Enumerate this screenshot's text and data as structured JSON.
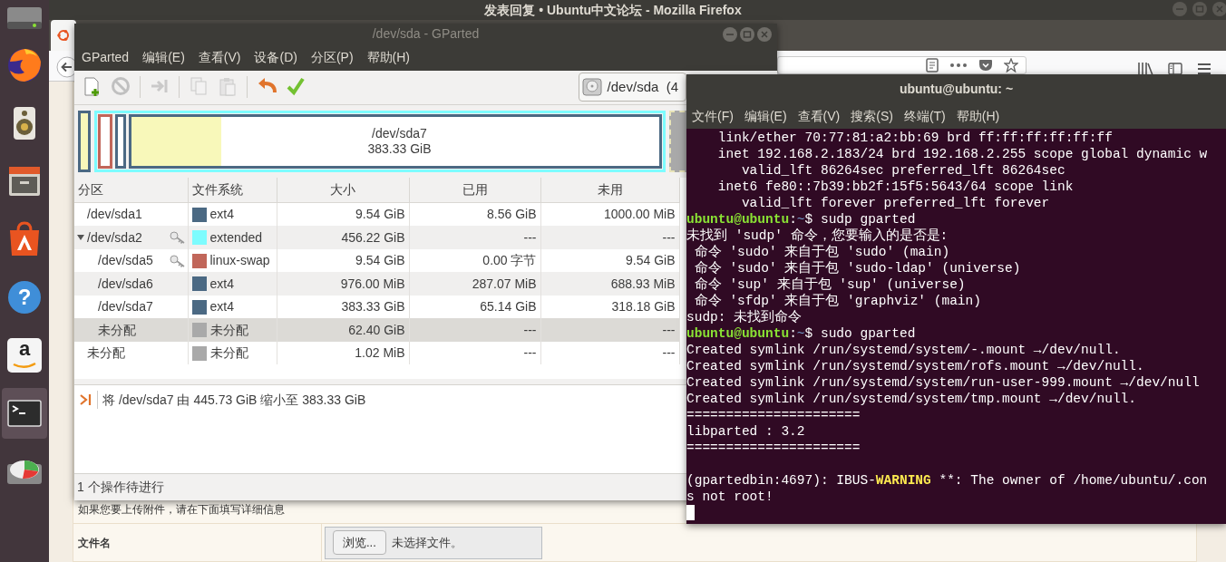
{
  "launcher": [
    {
      "kind": "drive",
      "active": false
    },
    {
      "kind": "firefox",
      "active": false
    },
    {
      "kind": "speaker",
      "active": false
    },
    {
      "kind": "files",
      "active": false
    },
    {
      "kind": "store",
      "active": false
    },
    {
      "kind": "help",
      "active": false,
      "glyph": "?"
    },
    {
      "kind": "amazon",
      "active": false,
      "glyph": "a"
    },
    {
      "kind": "terminal",
      "active": true
    },
    {
      "kind": "disk",
      "active": false
    }
  ],
  "firefox": {
    "title": "发表回复 • Ubuntu中文论坛 - Mozilla Firefox",
    "attach_hint": "如果您要上传附件，请在下面填写详细信息",
    "file_label": "文件名",
    "browse_button": "浏览...",
    "file_status": "未选择文件。"
  },
  "gparted": {
    "title": "/dev/sda - GParted",
    "menu": [
      "GParted",
      "编辑(E)",
      "查看(V)",
      "设备(D)",
      "分区(P)",
      "帮助(H)"
    ],
    "toolbar": [
      {
        "kind": "new",
        "disabled": false
      },
      {
        "kind": "delete",
        "disabled": true
      },
      {
        "kind": "separator"
      },
      {
        "kind": "resize",
        "disabled": true
      },
      {
        "kind": "separator"
      },
      {
        "kind": "copy",
        "disabled": true
      },
      {
        "kind": "paste",
        "disabled": true
      },
      {
        "kind": "separator"
      },
      {
        "kind": "undo",
        "disabled": false
      },
      {
        "kind": "apply",
        "disabled": false
      }
    ],
    "device": "/dev/sda  (4",
    "partition_map": {
      "label": "/dev/sda7",
      "size": "383.33 GiB",
      "level": 0.17
    },
    "columns": [
      "分区",
      "文件系统",
      "大小",
      "已用",
      "未用"
    ],
    "rows": [
      {
        "partition": "/dev/sda1",
        "filesystem": "ext4",
        "color": "#4b6983",
        "size": "9.54 GiB",
        "used": "8.56 GiB",
        "unused": "1000.00 MiB",
        "locked": false,
        "selected": false
      },
      {
        "partition": "/dev/sda2",
        "filesystem": "extended",
        "color": "#7dfcfe",
        "size": "456.22 GiB",
        "used": "---",
        "unused": "---",
        "locked": true,
        "selected": false,
        "expanded": true,
        "children": [
          {
            "partition": "/dev/sda5",
            "filesystem": "linux-swap",
            "color": "#c1665a",
            "size": "9.54 GiB",
            "used": "0.00 字节",
            "unused": "9.54 GiB",
            "locked": true,
            "selected": false
          },
          {
            "partition": "/dev/sda6",
            "filesystem": "ext4",
            "color": "#4b6983",
            "size": "976.00 MiB",
            "used": "287.07 MiB",
            "unused": "688.93 MiB",
            "locked": false,
            "selected": false
          },
          {
            "partition": "/dev/sda7",
            "filesystem": "ext4",
            "color": "#4b6983",
            "size": "383.33 GiB",
            "used": "65.14 GiB",
            "unused": "318.18 GiB",
            "locked": false,
            "selected": false
          },
          {
            "partition": "未分配",
            "filesystem": "未分配",
            "color": "#a9a9a9",
            "size": "62.40 GiB",
            "used": "---",
            "unused": "---",
            "locked": false,
            "selected": true
          }
        ]
      },
      {
        "partition": "未分配",
        "filesystem": "未分配",
        "color": "#a9a9a9",
        "size": "1.02 MiB",
        "used": "---",
        "unused": "---",
        "locked": false,
        "selected": false
      }
    ],
    "operations": [
      "将 /dev/sda7 由 445.73 GiB 缩小至 383.33 GiB"
    ],
    "status": "1 个操作待进行"
  },
  "terminal": {
    "title": "ubuntu@ubuntu: ~",
    "menu": [
      "文件(F)",
      "编辑(E)",
      "查看(V)",
      "搜索(S)",
      "终端(T)",
      "帮助(H)"
    ],
    "lines": [
      {
        "kind": "text",
        "text": "    link/ether 70:77:81:a2:bb:69 brd ff:ff:ff:ff:ff:ff"
      },
      {
        "kind": "text",
        "text": "    inet 192.168.2.183/24 brd 192.168.2.255 scope global dynamic w"
      },
      {
        "kind": "text",
        "text": "       valid_lft 86264sec preferred_lft 86264sec"
      },
      {
        "kind": "text",
        "text": "    inet6 fe80::7b39:bb2f:15f5:5643/64 scope link"
      },
      {
        "kind": "text",
        "text": "       valid_lft forever preferred_lft forever"
      },
      {
        "kind": "prompt",
        "user": "ubuntu@ubuntu",
        "sep": ":",
        "path": "~",
        "command": "$ sudp gparted"
      },
      {
        "kind": "text",
        "text": "未找到 'sudp' 命令，您要输入的是否是:"
      },
      {
        "kind": "text",
        "text": " 命令 'sudo' 来自于包 'sudo' (main)"
      },
      {
        "kind": "text",
        "text": " 命令 'sudo' 来自于包 'sudo-ldap' (universe)"
      },
      {
        "kind": "text",
        "text": " 命令 'sup' 来自于包 'sup' (universe)"
      },
      {
        "kind": "text",
        "text": " 命令 'sfdp' 来自于包 'graphviz' (main)"
      },
      {
        "kind": "text",
        "text": "sudp: 未找到命令"
      },
      {
        "kind": "prompt",
        "user": "ubuntu@ubuntu",
        "sep": ":",
        "path": "~",
        "command": "$ sudo gparted"
      },
      {
        "kind": "text",
        "text": "Created symlink /run/systemd/system/-.mount →/dev/null."
      },
      {
        "kind": "text",
        "text": "Created symlink /run/systemd/system/rofs.mount →/dev/null."
      },
      {
        "kind": "text",
        "text": "Created symlink /run/systemd/system/run-user-999.mount →/dev/null"
      },
      {
        "kind": "text",
        "text": "Created symlink /run/systemd/system/tmp.mount →/dev/null."
      },
      {
        "kind": "text",
        "text": "======================"
      },
      {
        "kind": "text",
        "text": "libparted : 3.2"
      },
      {
        "kind": "text",
        "text": "======================"
      },
      {
        "kind": "blank"
      },
      {
        "kind": "warning",
        "before": "(gpartedbin:4697): IBUS-",
        "warn": "WARNING",
        "after": " **: The owner of /home/ubuntu/.con"
      },
      {
        "kind": "text",
        "text": "s not root!"
      },
      {
        "kind": "cursor"
      }
    ]
  }
}
